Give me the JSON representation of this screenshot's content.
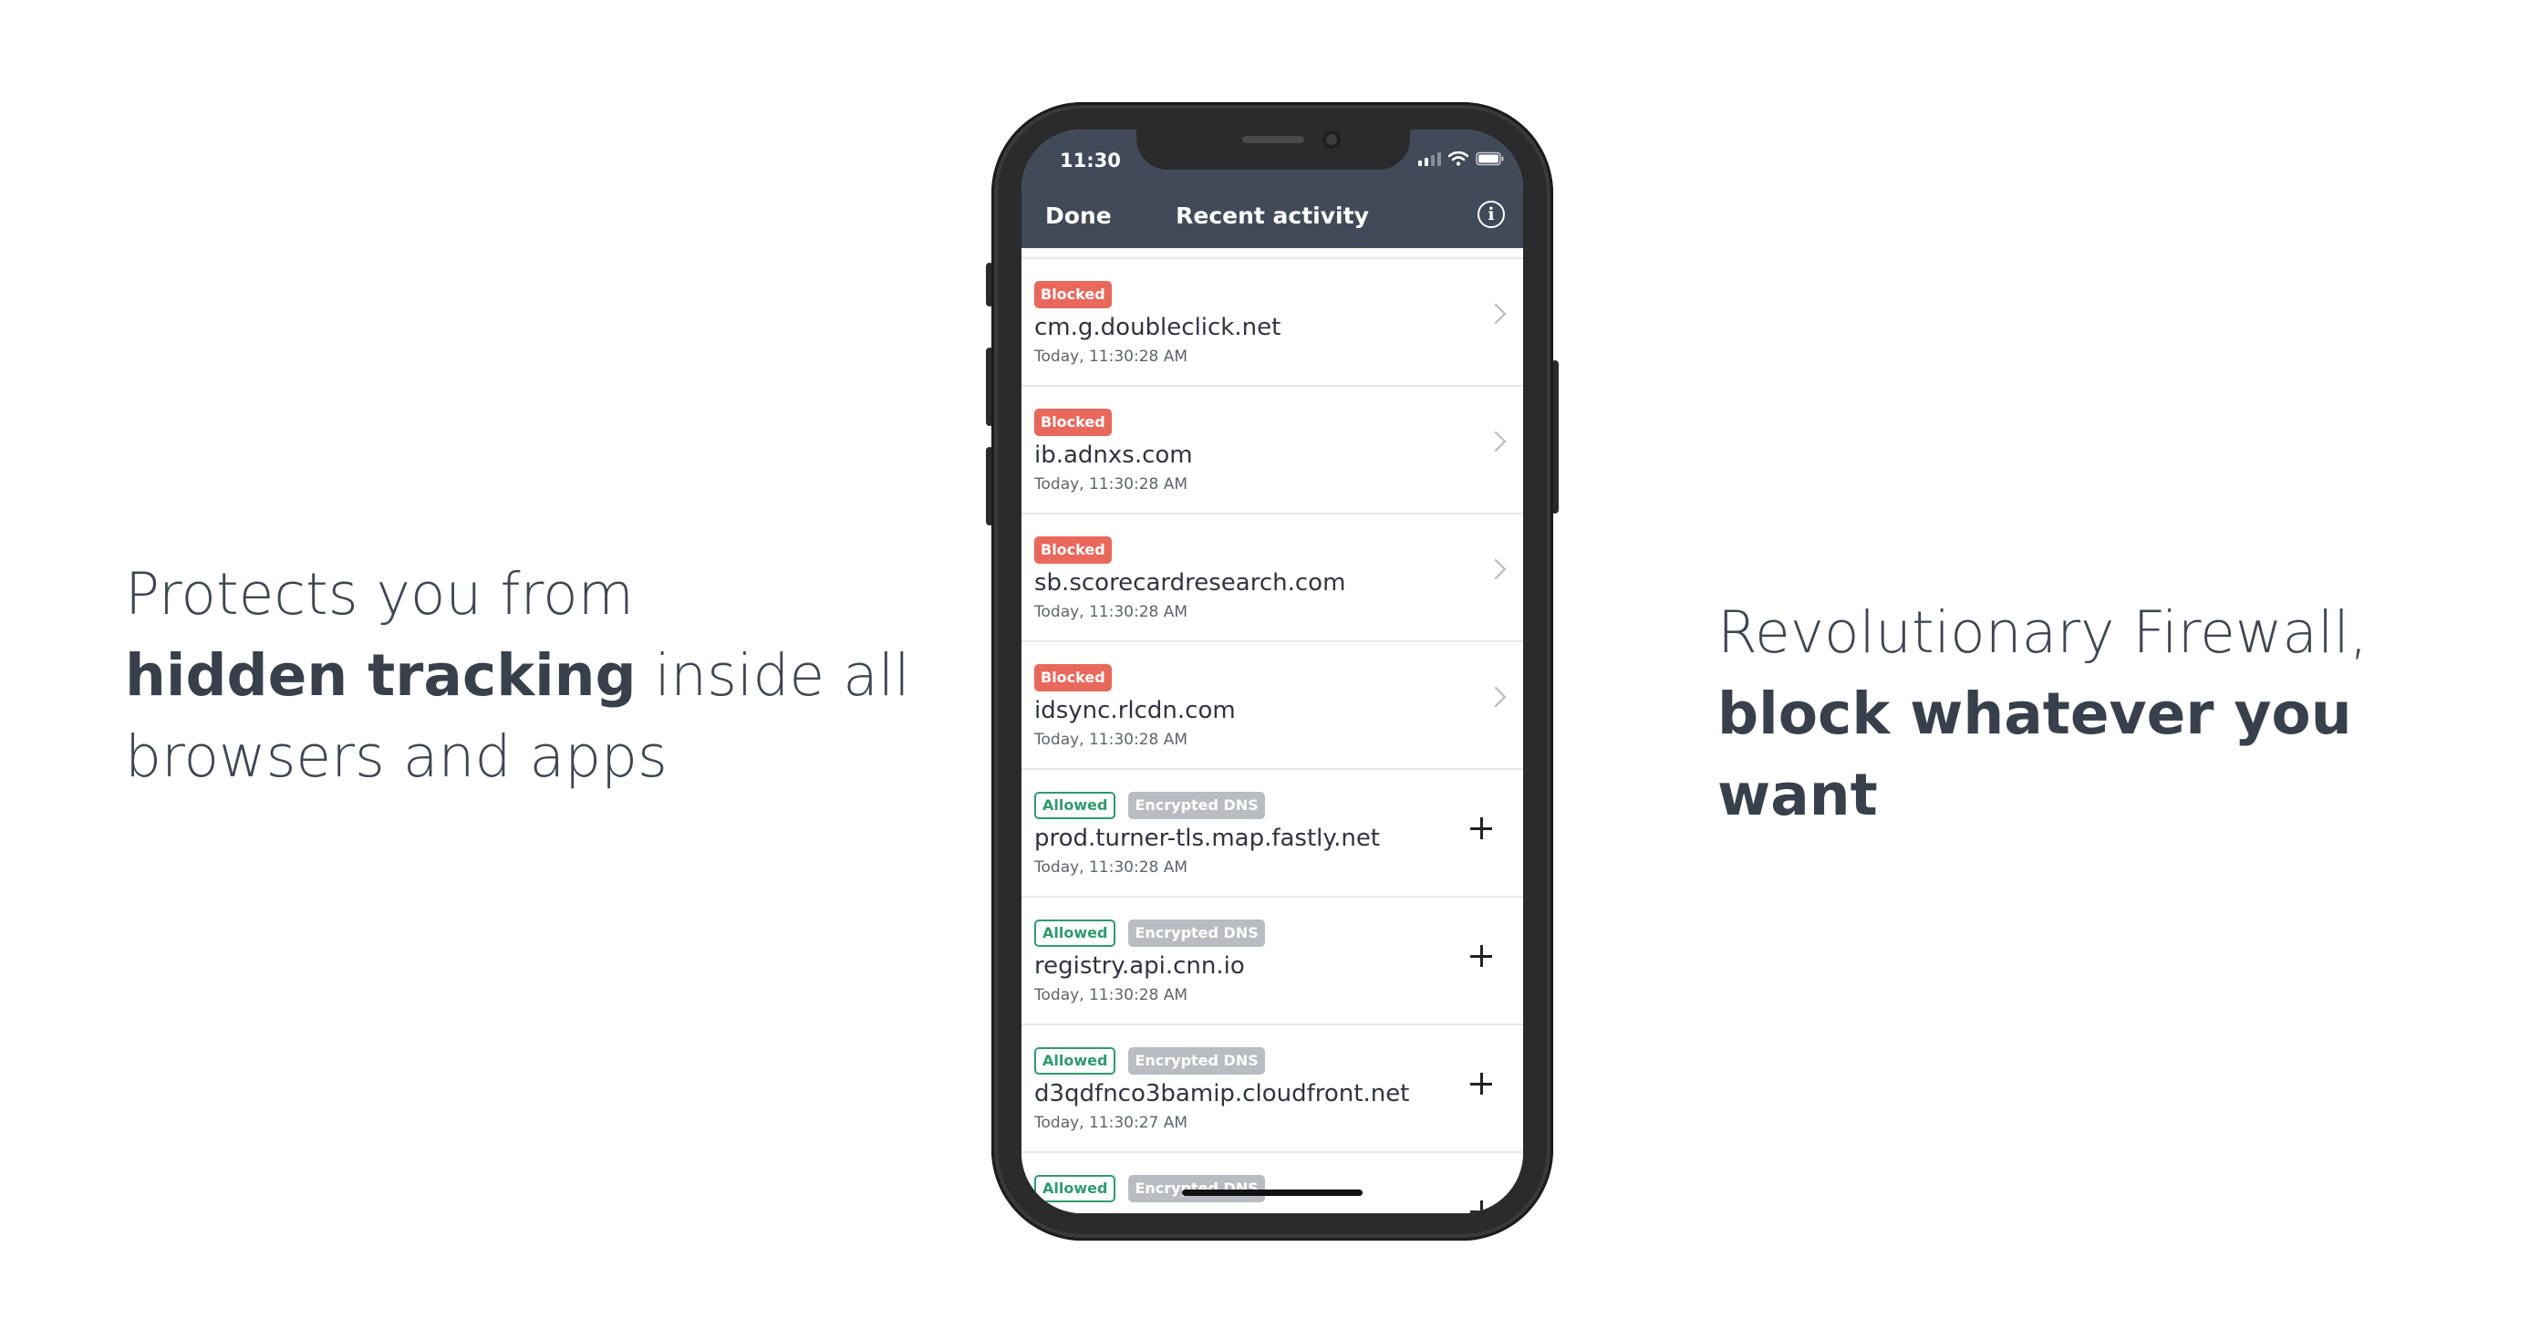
{
  "left_tagline": {
    "line1": "Protects you from",
    "bold": "hidden tracking",
    "rest": " inside all",
    "line3": "browsers and apps"
  },
  "right_tagline": {
    "line1": "Revolutionary Firewall,",
    "bold": "block whatever you want"
  },
  "phone": {
    "status_time": "11:30",
    "nav": {
      "done_label": "Done",
      "title": "Recent activity",
      "info_icon": "info-circle-icon"
    },
    "colors": {
      "header_bg": "#414a58",
      "blocked": "#e8685c",
      "allowed": "#2f9a6c",
      "encrypted_dns": "#b9bcc2"
    },
    "activity": [
      {
        "status": "Blocked",
        "domain": "cm.g.doubleclick.net",
        "time": "Today, 11:30:28 AM",
        "action_icon": "chevron-right-icon"
      },
      {
        "status": "Blocked",
        "domain": "ib.adnxs.com",
        "time": "Today, 11:30:28 AM",
        "action_icon": "chevron-right-icon"
      },
      {
        "status": "Blocked",
        "domain": "sb.scorecardresearch.com",
        "time": "Today, 11:30:28 AM",
        "action_icon": "chevron-right-icon"
      },
      {
        "status": "Blocked",
        "domain": "idsync.rlcdn.com",
        "time": "Today, 11:30:28 AM",
        "action_icon": "chevron-right-icon"
      },
      {
        "status": "Allowed",
        "extra": "Encrypted DNS",
        "domain": "prod.turner-tls.map.fastly.net",
        "time": "Today, 11:30:28 AM",
        "action_icon": "plus-icon"
      },
      {
        "status": "Allowed",
        "extra": "Encrypted DNS",
        "domain": "registry.api.cnn.io",
        "time": "Today, 11:30:28 AM",
        "action_icon": "plus-icon"
      },
      {
        "status": "Allowed",
        "extra": "Encrypted DNS",
        "domain": "d3qdfnco3bamip.cloudfront.net",
        "time": "Today, 11:30:27 AM",
        "action_icon": "plus-icon"
      },
      {
        "status": "Allowed",
        "extra": "Encrypted DNS",
        "domain": "",
        "time": "",
        "action_icon": "plus-icon"
      }
    ]
  }
}
